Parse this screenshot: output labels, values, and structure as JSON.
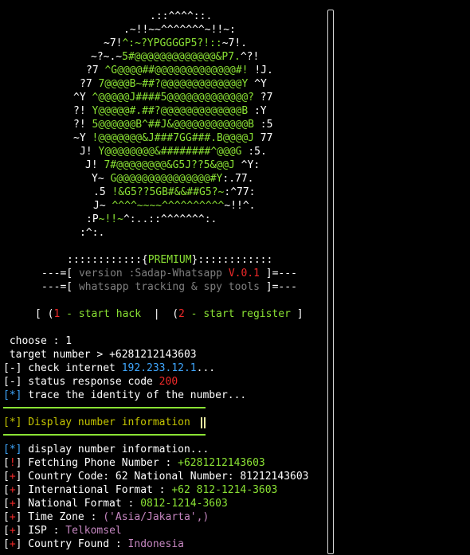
{
  "logo_art": [
    {
      "cls": "w",
      "text": ".::^^^^::."
    },
    {
      "cls": "w",
      "text": ".~!!~~^^^^^^^~!!~:"
    },
    {
      "cls": "mix",
      "parts": [
        {
          "c": "w",
          "t": "~7!"
        },
        {
          "c": "g",
          "t": "^:~?YPGGGGP5?!::"
        },
        {
          "c": "w",
          "t": "~7!."
        }
      ]
    },
    {
      "cls": "mix",
      "parts": [
        {
          "c": "w",
          "t": "~?~.~"
        },
        {
          "c": "g",
          "t": "5#@@@@@@@@@@@@@&P7."
        },
        {
          "c": "w",
          "t": "^?!"
        }
      ]
    },
    {
      "cls": "mix",
      "parts": [
        {
          "c": "w",
          "t": "?7 "
        },
        {
          "c": "g",
          "t": "^G@@@@##@@@@@@@@@@@@@#!"
        },
        {
          "c": "w",
          "t": " !J."
        }
      ]
    },
    {
      "cls": "mix",
      "parts": [
        {
          "c": "w",
          "t": "?7 "
        },
        {
          "c": "g",
          "t": "7@@@@B~##?@@@@@@@@@@@@@Y"
        },
        {
          "c": "w",
          "t": " ^Y"
        }
      ]
    },
    {
      "cls": "mix",
      "parts": [
        {
          "c": "w",
          "t": "^Y "
        },
        {
          "c": "g",
          "t": "^@@@@@J####5@@@@@@@@@@@@@?"
        },
        {
          "c": "w",
          "t": " ?7"
        }
      ]
    },
    {
      "cls": "mix",
      "parts": [
        {
          "c": "w",
          "t": "?! "
        },
        {
          "c": "g",
          "t": "Y@@@@@#.##?@@@@@@@@@@@@@B"
        },
        {
          "c": "w",
          "t": " :Y"
        }
      ]
    },
    {
      "cls": "mix",
      "parts": [
        {
          "c": "w",
          "t": "?! "
        },
        {
          "c": "g",
          "t": "5@@@@@@B^##J&@@@@@@@@@@@@B"
        },
        {
          "c": "w",
          "t": " :5"
        }
      ]
    },
    {
      "cls": "mix",
      "parts": [
        {
          "c": "w",
          "t": "~Y "
        },
        {
          "c": "g",
          "t": "!@@@@@@@&J###7GG###.B@@@@J"
        },
        {
          "c": "w",
          "t": " 77"
        }
      ]
    },
    {
      "cls": "mix",
      "parts": [
        {
          "c": "w",
          "t": "J! "
        },
        {
          "c": "g",
          "t": "Y@@@@@@@@&########^@@@G"
        },
        {
          "c": "w",
          "t": " :5."
        }
      ]
    },
    {
      "cls": "mix",
      "parts": [
        {
          "c": "w",
          "t": "J! "
        },
        {
          "c": "g",
          "t": "7#@@@@@@@@&G5J??5&@@J"
        },
        {
          "c": "w",
          "t": " ^Y:"
        }
      ]
    },
    {
      "cls": "mix",
      "parts": [
        {
          "c": "w",
          "t": "Y~ "
        },
        {
          "c": "g",
          "t": "G@@@@@@@@@@@@@@@#Y"
        },
        {
          "c": "w",
          "t": ":.77."
        }
      ]
    },
    {
      "cls": "mix",
      "parts": [
        {
          "c": "w",
          "t": ".5 "
        },
        {
          "c": "g",
          "t": "!&G5??5GB#&&##G5?~"
        },
        {
          "c": "w",
          "t": ":^77:"
        }
      ]
    },
    {
      "cls": "mix",
      "parts": [
        {
          "c": "w",
          "t": "J~ "
        },
        {
          "c": "g",
          "t": "^^^^~~~~^^^^^^^^^^"
        },
        {
          "c": "w",
          "t": "~!!^."
        }
      ]
    },
    {
      "cls": "mix",
      "parts": [
        {
          "c": "w",
          "t": ":P"
        },
        {
          "c": "g",
          "t": "~!!~"
        },
        {
          "c": "w",
          "t": "^:..::^^^^^^^:."
        }
      ]
    },
    {
      "cls": "w",
      "text": ":^:."
    }
  ],
  "banner": {
    "premium_left": "::::::::::::",
    "premium_open": "{",
    "premium_label": "PREMIUM",
    "premium_close": "}",
    "premium_right": "::::::::::::",
    "version_prefix": "---=[",
    "version_text": " version :Sadap-Whatsapp ",
    "version_number": "V.0.1",
    "version_suffix": " ]=---",
    "tagline_prefix": "---=[",
    "tagline_text": " whatsapp tracking & spy tools ",
    "tagline_suffix": "]=---"
  },
  "menu": {
    "open1": "[ (",
    "num1": "1",
    "label1": " - start hack",
    "sep": "  |  ",
    "open2": "(",
    "num2": "2",
    "label2": " - start register",
    "close": " ]"
  },
  "session": {
    "choose_prompt": " choose : ",
    "choose_value": "1",
    "target_prompt": " target number > ",
    "target_value": "+6281212143603",
    "check_internet_label": " check internet ",
    "check_internet_ip": "192.233.12.1",
    "check_internet_suffix": "...",
    "status_label": " status response code ",
    "status_code": "200",
    "trace_label": " trace the identity of the number...",
    "section_title": "[*] Display number information",
    "display_label": " display number information...",
    "fetching_label": " Fetching Phone Number : ",
    "fetching_value": "+6281212143603",
    "country_code_label": " Country Code: 62 National Number: 81212143603",
    "intl_label": " International Format : ",
    "intl_value": "+62 812-1214-3603",
    "national_label": " National Format : ",
    "national_value": "0812-1214-3603",
    "timezone_label": " Time Zone : ",
    "timezone_value": "('Asia/Jakarta',)",
    "isp_label": " ISP : ",
    "isp_value": "Telkomsel",
    "country_found_label": " Country Found : ",
    "country_found_value": "Indonesia"
  },
  "markers": {
    "minus": "-",
    "star": "*",
    "bang": "!",
    "plus": "+"
  },
  "colors": {
    "green": "#8ae234",
    "red": "#ef2929",
    "blue": "#3fa7ff",
    "purple": "#c586c0",
    "gray": "#7f7f7f"
  }
}
